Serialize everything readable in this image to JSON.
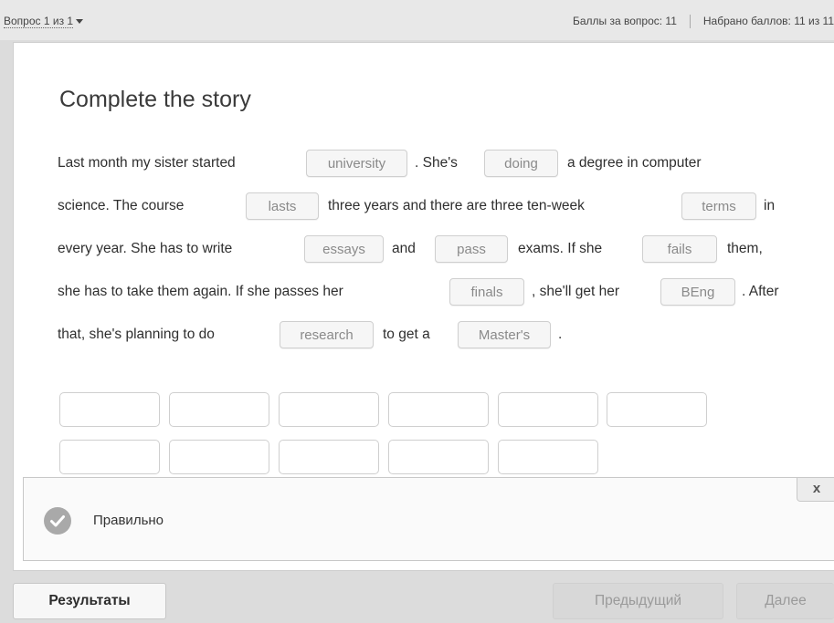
{
  "topbar": {
    "question_nav": "Вопрос 1 из 1",
    "points_for_question": "Баллы за вопрос: 11",
    "points_scored": "Набрано баллов: 11 из 11"
  },
  "exercise": {
    "title": "Complete the story",
    "lines": [
      {
        "text1": "Last month my sister started",
        "chip1": "university",
        "text2": ". She's",
        "chip2": "doing",
        "text3": "a degree in computer"
      },
      {
        "text1": "science. The course",
        "chip1": "lasts",
        "text2": "three years and there are three ten-week",
        "chip2": "terms",
        "text3": "in"
      },
      {
        "text1": "every year. She has to write",
        "chip1": "essays",
        "text2": "and",
        "chip2": "pass",
        "text3": "exams. If she",
        "chip3": "fails",
        "text4": "them,"
      },
      {
        "text1": "she has to take them again. If she passes her",
        "chip1": "finals",
        "text2": ", she'll get her",
        "chip2": "BEng",
        "text3": ". After"
      },
      {
        "text1": "that, she's planning to do",
        "chip1": "research",
        "text2": "to get a",
        "chip2": "Master's",
        "text3": "."
      }
    ]
  },
  "feedback": {
    "result_text": "Правильно",
    "close_label": "x"
  },
  "footer": {
    "results_label": "Результаты",
    "prev_label": "Предыдущий",
    "next_label": "Далее"
  },
  "colors": {
    "background": "#dcdcdc",
    "card": "#ffffff",
    "chip_text": "#8a8a8a",
    "success_icon": "#a9a9a9"
  },
  "icons": {
    "dropdown": "caret-down-icon",
    "correct": "check-circle-icon"
  }
}
